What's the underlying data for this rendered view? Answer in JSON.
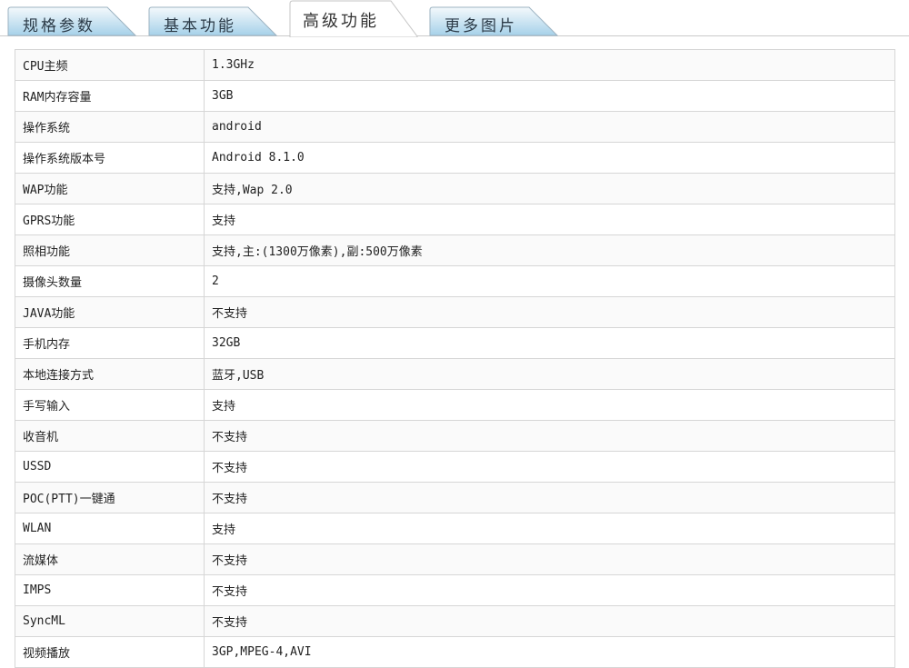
{
  "tabs": [
    {
      "label": "规格参数",
      "active": false
    },
    {
      "label": "基本功能",
      "active": false
    },
    {
      "label": "高级功能",
      "active": true
    },
    {
      "label": "更多图片",
      "active": false
    }
  ],
  "specs": [
    {
      "key": "CPU主频",
      "value": "1.3GHz"
    },
    {
      "key": "RAM内存容量",
      "value": "3GB"
    },
    {
      "key": "操作系统",
      "value": "android"
    },
    {
      "key": "操作系统版本号",
      "value": "Android 8.1.0"
    },
    {
      "key": "WAP功能",
      "value": "支持,Wap 2.0"
    },
    {
      "key": "GPRS功能",
      "value": "支持"
    },
    {
      "key": "照相功能",
      "value": "支持,主:(1300万像素),副:500万像素"
    },
    {
      "key": "摄像头数量",
      "value": "2"
    },
    {
      "key": "JAVA功能",
      "value": "不支持"
    },
    {
      "key": "手机内存",
      "value": "32GB"
    },
    {
      "key": "本地连接方式",
      "value": "蓝牙,USB"
    },
    {
      "key": "手写输入",
      "value": "支持"
    },
    {
      "key": "收音机",
      "value": "不支持"
    },
    {
      "key": "USSD",
      "value": "不支持"
    },
    {
      "key": "POC(PTT)一键通",
      "value": "不支持"
    },
    {
      "key": "WLAN",
      "value": "支持"
    },
    {
      "key": "流媒体",
      "value": "不支持"
    },
    {
      "key": "IMPS",
      "value": "不支持"
    },
    {
      "key": "SyncML",
      "value": "不支持"
    },
    {
      "key": "视频播放",
      "value": "3GP,MPEG-4,AVI"
    }
  ],
  "colors": {
    "tab_fill_top": "#eef6fb",
    "tab_fill_bottom": "#a9d3ea",
    "tab_active_fill": "#ffffff",
    "border": "#d6d6d6"
  }
}
